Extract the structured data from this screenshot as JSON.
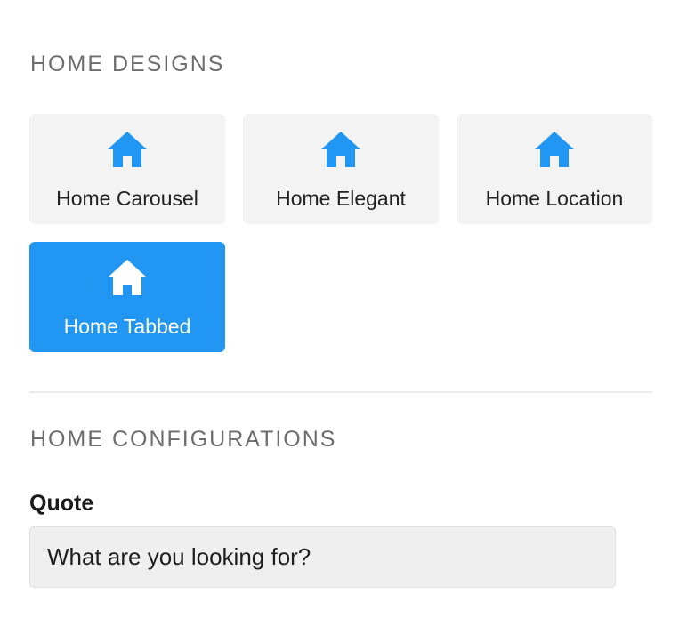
{
  "colors": {
    "accent": "#2196f3",
    "card_background": "#f3f3f3",
    "section_title": "#6d6d6d"
  },
  "home_designs": {
    "title": "HOME DESIGNS",
    "items": [
      {
        "label": "Home Carousel",
        "icon": "home-icon",
        "selected": false
      },
      {
        "label": "Home Elegant",
        "icon": "home-icon",
        "selected": false
      },
      {
        "label": "Home Location",
        "icon": "home-icon",
        "selected": false
      },
      {
        "label": "Home Tabbed",
        "icon": "home-icon",
        "selected": true
      }
    ]
  },
  "home_configurations": {
    "title": "HOME CONFIGURATIONS",
    "quote": {
      "label": "Quote",
      "value": "What are you looking for?"
    }
  }
}
